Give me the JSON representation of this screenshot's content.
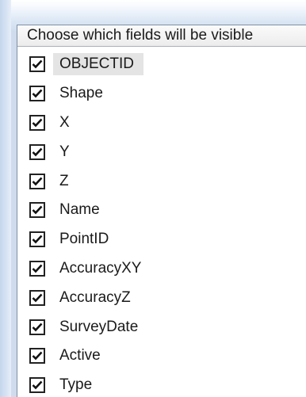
{
  "header": {
    "title": "Choose which fields will be visible"
  },
  "fields": [
    {
      "label": "OBJECTID",
      "checked": true,
      "selected": true
    },
    {
      "label": "Shape",
      "checked": true,
      "selected": false
    },
    {
      "label": "X",
      "checked": true,
      "selected": false
    },
    {
      "label": "Y",
      "checked": true,
      "selected": false
    },
    {
      "label": "Z",
      "checked": true,
      "selected": false
    },
    {
      "label": "Name",
      "checked": true,
      "selected": false
    },
    {
      "label": "PointID",
      "checked": true,
      "selected": false
    },
    {
      "label": "AccuracyXY",
      "checked": true,
      "selected": false
    },
    {
      "label": "AccuracyZ",
      "checked": true,
      "selected": false
    },
    {
      "label": "SurveyDate",
      "checked": true,
      "selected": false
    },
    {
      "label": "Active",
      "checked": true,
      "selected": false
    },
    {
      "label": "Type",
      "checked": true,
      "selected": false
    }
  ],
  "colors": {
    "accent_chrome": "#cfdcee",
    "selection_bg": "#e4e4e4"
  }
}
